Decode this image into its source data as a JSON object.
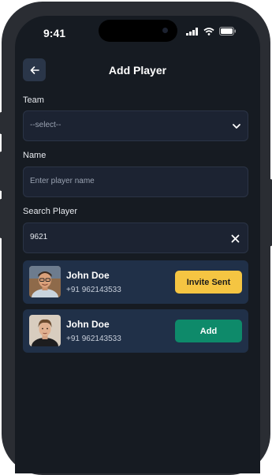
{
  "status_bar": {
    "time": "9:41"
  },
  "header": {
    "title": "Add Player"
  },
  "team": {
    "label": "Team",
    "selected": "--select--"
  },
  "name": {
    "label": "Name",
    "placeholder": "Enter player name"
  },
  "search": {
    "label": "Search Player",
    "value": "9621"
  },
  "players": [
    {
      "name": "John Doe",
      "phone": "+91 962143533",
      "action": "Invite Sent",
      "action_color": "#f5c542"
    },
    {
      "name": "John Doe",
      "phone": "+91 962143533",
      "action": "Add",
      "action_color": "#0e8a6a"
    }
  ],
  "colors": {
    "background": "#161b22",
    "card": "#203048",
    "field": "#1c2332"
  }
}
